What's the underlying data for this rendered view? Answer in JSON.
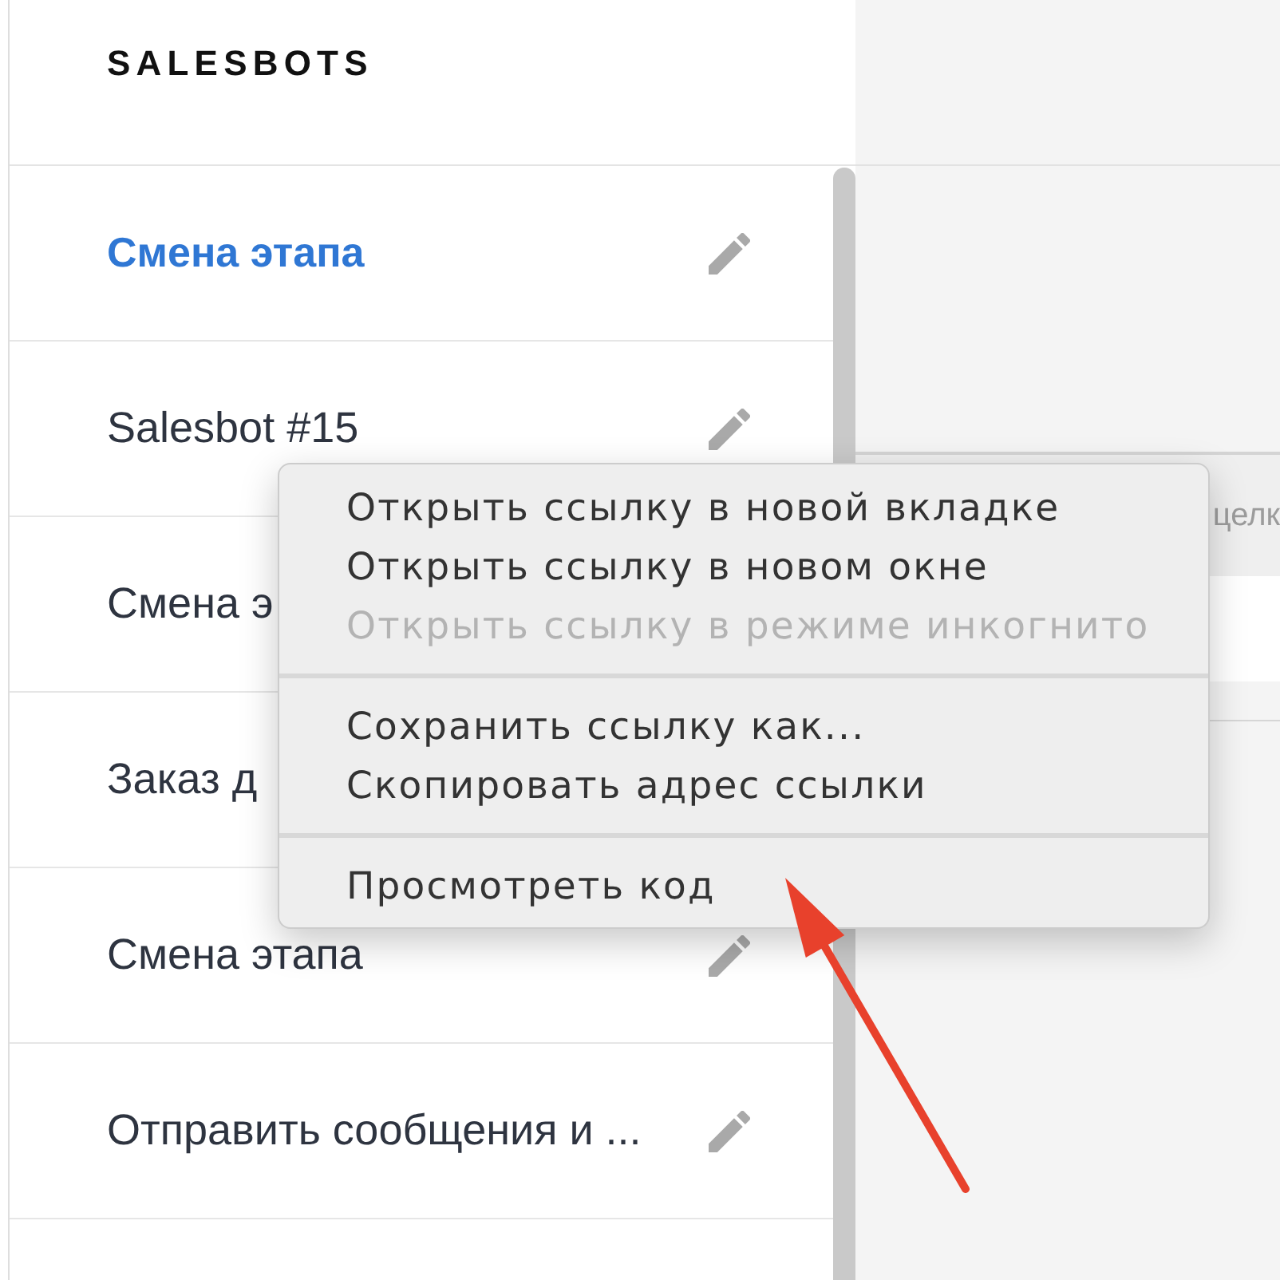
{
  "sidebar": {
    "title": "SALESBOTS",
    "items": [
      {
        "label": "Смена этапа",
        "selected": true,
        "edit_icon": true
      },
      {
        "label": "Salesbot #15",
        "selected": false,
        "edit_icon": true
      },
      {
        "label": "Смена э",
        "selected": false,
        "edit_icon": false
      },
      {
        "label": "Заказ д",
        "selected": false,
        "edit_icon": false
      },
      {
        "label": "Смена этапа",
        "selected": false,
        "edit_icon": true
      },
      {
        "label": "Отправить сообщения и ...",
        "selected": false,
        "edit_icon": true
      }
    ]
  },
  "main": {
    "panel_text": "целк"
  },
  "context_menu": {
    "groups": [
      {
        "items": [
          {
            "label": "Открыть ссылку в новой вкладке",
            "disabled": false
          },
          {
            "label": "Открыть ссылку в новом окне",
            "disabled": false
          },
          {
            "label": "Открыть ссылку в режиме инкогнито",
            "disabled": true
          }
        ]
      },
      {
        "items": [
          {
            "label": "Сохранить ссылку как...",
            "disabled": false
          },
          {
            "label": "Скопировать адрес ссылки",
            "disabled": false
          }
        ]
      },
      {
        "items": [
          {
            "label": "Просмотреть код",
            "disabled": false
          }
        ]
      }
    ]
  }
}
